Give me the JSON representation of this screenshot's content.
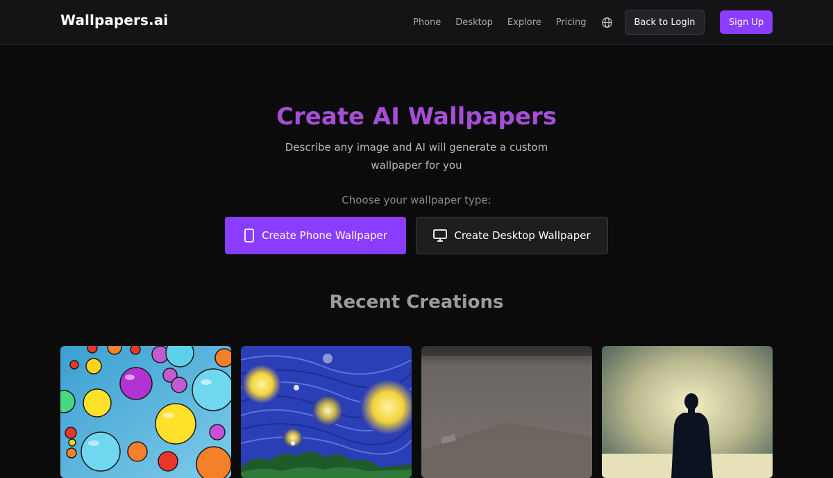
{
  "header": {
    "brand": "Wallpapers.ai",
    "nav": [
      "Phone",
      "Desktop",
      "Explore",
      "Pricing"
    ],
    "back_to_login": "Back to Login",
    "sign_up": "Sign Up"
  },
  "hero": {
    "title": "Create AI Wallpapers",
    "subtitle": "Describe any image and AI will generate a custom wallpaper for you",
    "choose_label": "Choose your wallpaper type:",
    "phone_button": "Create Phone Wallpaper",
    "desktop_button": "Create Desktop Wallpaper"
  },
  "recent": {
    "title": "Recent Creations"
  },
  "icons": {
    "language": "globe-icon",
    "phone": "phone-icon",
    "desktop": "monitor-icon"
  },
  "colors": {
    "accent": "#8b3dff",
    "title": "#a64ed6",
    "background": "#0b0b0c"
  }
}
